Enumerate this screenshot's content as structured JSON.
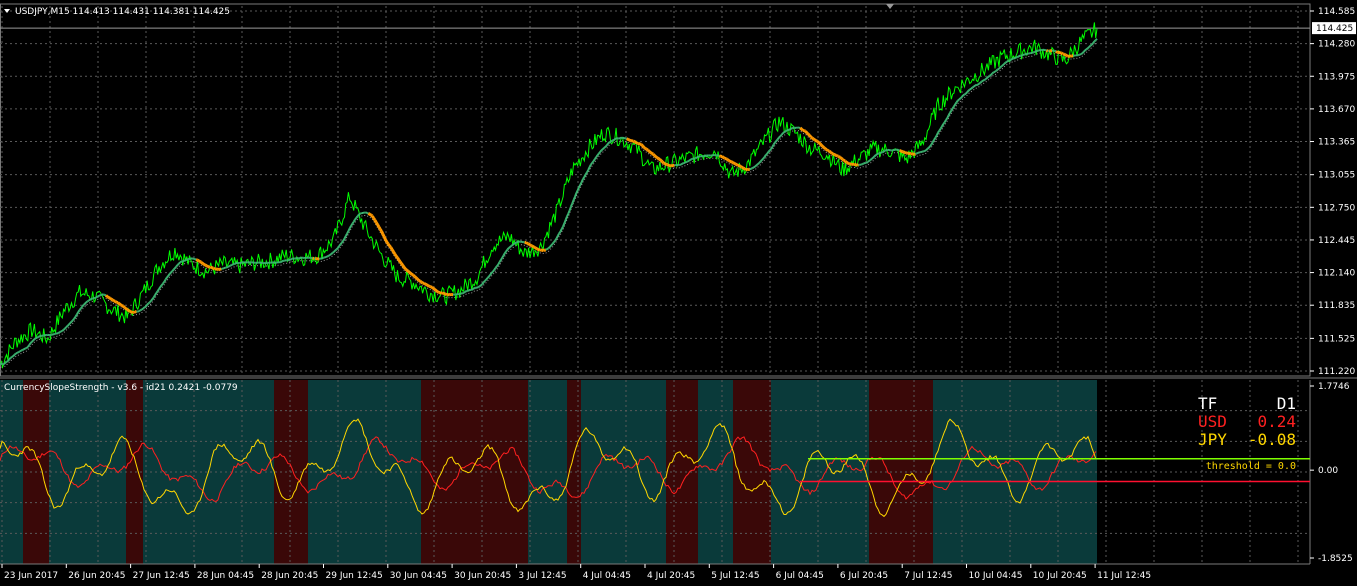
{
  "price_panel": {
    "symbol_label": "USDJPY,M15  114.413 114.431 114.381 114.425",
    "current_price": "114.425",
    "y_ticks": [
      "114.585",
      "114.280",
      "113.975",
      "113.670",
      "113.365",
      "113.055",
      "112.750",
      "112.445",
      "112.140",
      "111.835",
      "111.525",
      "111.220"
    ],
    "ylim": [
      111.22,
      114.585
    ]
  },
  "indicator_panel": {
    "label": "CurrencySlopeStrength - v3.6 - id21 0.2421 -0.0779",
    "y_ticks": [
      "1.7746",
      "0.00",
      "-1.8525"
    ],
    "ylim": [
      -1.8525,
      1.7746
    ],
    "tf_label": "TF",
    "tf_value": "D1",
    "rows": [
      {
        "currency": "USD",
        "value": "0.24",
        "color": "#ff2020"
      },
      {
        "currency": "JPY",
        "value": "-0.08",
        "color": "#ffd700"
      }
    ],
    "threshold_label": "threshold = 0.0",
    "upper_line_color": "#7fff00",
    "lower_line_color": "#ff1030"
  },
  "time_axis": [
    "23 Jun 2017",
    "26 Jun 20:45",
    "27 Jun 12:45",
    "28 Jun 04:45",
    "28 Jun 20:45",
    "29 Jun 12:45",
    "30 Jun 04:45",
    "30 Jun 20:45",
    "3 Jul 12:45",
    "4 Jul 04:45",
    "4 Jul 20:45",
    "5 Jul 12:45",
    "6 Jul 04:45",
    "6 Jul 20:45",
    "7 Jul 12:45",
    "10 Jul 04:45",
    "10 Jul 20:45",
    "11 Jul 12:45"
  ],
  "colors": {
    "background": "#000000",
    "grid": "#5a5a5a",
    "price": "#00ff00",
    "ma": "#3cb371",
    "ma_down": "#ff9900",
    "bg_teal": "#0a3a3a",
    "bg_red": "#3a0808",
    "usd_line": "#ff2020",
    "jpy_line": "#ffd700"
  },
  "chart_data": {
    "type": "line",
    "title": "USDJPY,M15",
    "price_series": {
      "name": "USDJPY",
      "x_index": [
        0,
        1,
        2,
        3,
        4,
        5,
        6,
        7,
        8,
        9,
        10,
        11,
        12,
        13,
        14,
        15,
        16,
        17,
        18,
        19,
        20,
        21,
        22,
        23,
        24,
        25,
        26,
        27,
        28,
        29,
        30,
        31,
        32,
        33,
        34,
        35,
        36,
        37,
        38,
        39,
        40,
        41,
        42,
        43,
        44,
        45,
        46,
        47,
        48,
        49,
        50,
        51,
        52,
        53,
        54,
        55,
        56,
        57,
        58,
        59,
        60,
        61,
        62,
        63,
        64,
        65,
        66,
        67,
        68,
        69
      ],
      "values": [
        111.28,
        111.5,
        111.6,
        111.52,
        111.78,
        111.95,
        111.92,
        111.8,
        111.72,
        111.95,
        112.2,
        112.35,
        112.22,
        112.15,
        112.22,
        112.2,
        112.23,
        112.25,
        112.3,
        112.28,
        112.3,
        112.45,
        112.85,
        112.55,
        112.3,
        112.1,
        112.05,
        111.95,
        111.92,
        111.98,
        112.1,
        112.4,
        112.48,
        112.32,
        112.38,
        112.7,
        113.1,
        113.3,
        113.45,
        113.4,
        113.3,
        113.1,
        113.15,
        113.2,
        113.25,
        113.28,
        113.05,
        113.15,
        113.35,
        113.55,
        113.45,
        113.3,
        113.25,
        113.1,
        113.2,
        113.3,
        113.28,
        113.2,
        113.35,
        113.7,
        113.85,
        113.95,
        114.05,
        114.15,
        114.2,
        114.25,
        114.18,
        114.12,
        114.3,
        114.42
      ]
    },
    "strength_series": [
      {
        "name": "USD",
        "color": "#ff2020"
      },
      {
        "name": "JPY",
        "color": "#ffd700"
      }
    ]
  }
}
